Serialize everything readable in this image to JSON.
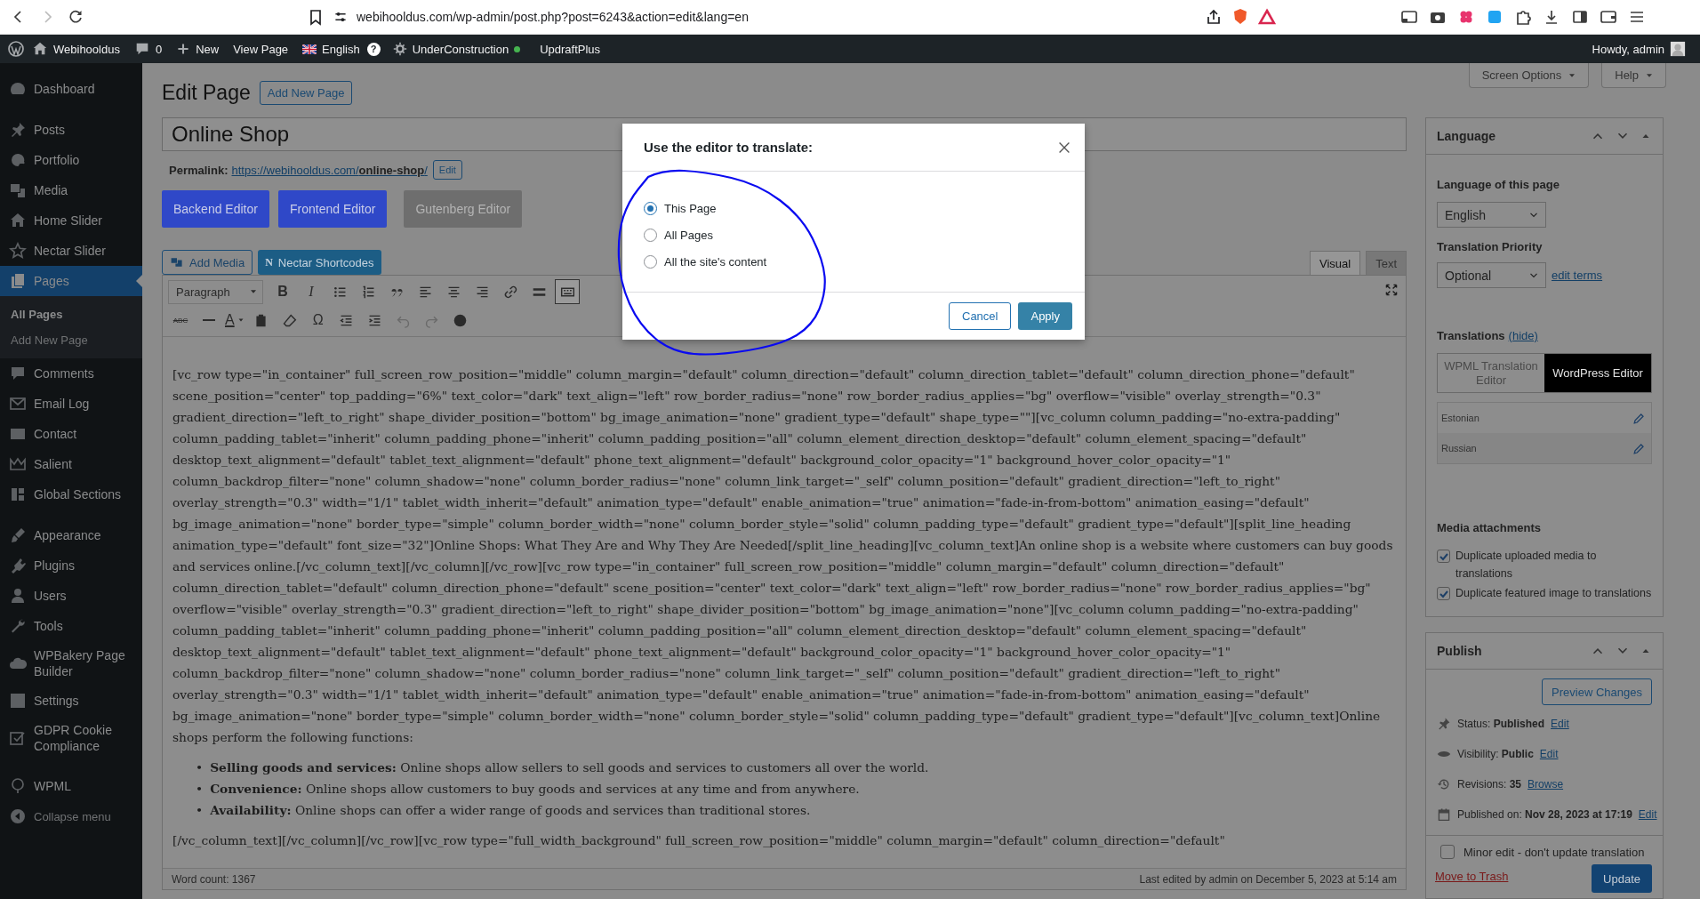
{
  "browser": {
    "url": "webihooldus.com/wp-admin/post.php?post=6243&action=edit&lang=en"
  },
  "admin_bar": {
    "site": "Webihooldus",
    "comments": "0",
    "new": "New",
    "view_page": "View Page",
    "language": "English",
    "help": "?",
    "under_construction": {
      "label": "UnderConstruction",
      "active": true
    },
    "updraft": "UpdraftPlus",
    "greeting": "Howdy, admin"
  },
  "sidebar": {
    "groups": [
      {
        "items": [
          {
            "label": "Dashboard",
            "selected": false
          }
        ]
      },
      {
        "items": [
          {
            "label": "Posts",
            "selected": false
          },
          {
            "label": "Portfolio",
            "selected": false
          },
          {
            "label": "Media",
            "selected": false
          },
          {
            "label": "Home Slider",
            "selected": false
          },
          {
            "label": "Nectar Slider",
            "selected": false
          },
          {
            "label": "Pages",
            "selected": true,
            "children": [
              {
                "label": "All Pages",
                "selected": true
              },
              {
                "label": "Add New Page",
                "selected": false
              }
            ]
          },
          {
            "label": "Comments",
            "selected": false
          },
          {
            "label": "Email Log",
            "selected": false
          },
          {
            "label": "Contact",
            "selected": false
          },
          {
            "label": "Salient",
            "selected": false
          },
          {
            "label": "Global Sections",
            "selected": false
          }
        ]
      },
      {
        "items": [
          {
            "label": "Appearance",
            "selected": false
          },
          {
            "label": "Plugins",
            "selected": false
          },
          {
            "label": "Users",
            "selected": false
          },
          {
            "label": "Tools",
            "selected": false
          },
          {
            "label": "WPBakery Page Builder",
            "selected": false
          },
          {
            "label": "Settings",
            "selected": false
          },
          {
            "label": "GDPR Cookie Compliance",
            "selected": false
          }
        ]
      },
      {
        "items": [
          {
            "label": "WPML",
            "selected": false
          }
        ]
      }
    ],
    "collapse": "Collapse menu"
  },
  "screen_tabs": [
    "Screen Options",
    "Help"
  ],
  "heading": "Edit Page",
  "add_new": "Add New Page",
  "editor": {
    "title": "Online Shop",
    "permalink_label": "Permalink:",
    "permalink_url": "https://webihooldus.com/**online-shop**/",
    "permalink_edit": "Edit",
    "builder_buttons": [
      {
        "label": "Backend Editor",
        "disabled": false
      },
      {
        "label": "Frontend Editor",
        "disabled": false
      },
      {
        "label": "Gutenberg Editor",
        "disabled": true
      }
    ],
    "media_buttons": [
      {
        "label": "Add Media"
      },
      {
        "label": "Nectar Shortcodes",
        "glyph": "N"
      }
    ],
    "tabs": [
      {
        "label": "Visual",
        "selected": true
      },
      {
        "label": "Text",
        "selected": false
      }
    ],
    "toolbar": [
      [
        {
          "kind": "select",
          "text": "Paragraph",
          "pressed": false,
          "disabled": false
        },
        {
          "kind": "bold",
          "text": "B",
          "pressed": false,
          "disabled": false
        },
        {
          "kind": "italic",
          "text": "I",
          "pressed": false,
          "disabled": false
        },
        {
          "kind": "icon",
          "pressed": false,
          "disabled": false
        },
        {
          "kind": "icon",
          "pressed": false,
          "disabled": false
        },
        {
          "kind": "icon",
          "pressed": false,
          "disabled": false
        },
        {
          "kind": "icon",
          "pressed": false,
          "disabled": false
        },
        {
          "kind": "icon",
          "pressed": false,
          "disabled": false
        },
        {
          "kind": "icon",
          "pressed": false,
          "disabled": false
        },
        {
          "kind": "icon",
          "pressed": false,
          "disabled": false
        },
        {
          "kind": "icon",
          "pressed": false,
          "disabled": false
        },
        {
          "kind": "icon",
          "pressed": true,
          "disabled": false
        }
      ],
      [
        {
          "kind": "strike",
          "text": "ABC",
          "pressed": false,
          "disabled": false
        },
        {
          "kind": "icon",
          "pressed": false,
          "disabled": false
        },
        {
          "kind": "color",
          "text": "A",
          "pressed": false,
          "disabled": false
        },
        {
          "kind": "icon",
          "pressed": false,
          "disabled": false
        },
        {
          "kind": "icon",
          "pressed": false,
          "disabled": false
        },
        {
          "kind": "glyph",
          "text": "Ω",
          "pressed": false,
          "disabled": false
        },
        {
          "kind": "icon",
          "pressed": false,
          "disabled": false
        },
        {
          "kind": "icon",
          "pressed": false,
          "disabled": false
        },
        {
          "kind": "icon",
          "pressed": false,
          "disabled": true
        },
        {
          "kind": "icon",
          "pressed": false,
          "disabled": true
        },
        {
          "kind": "icon",
          "pressed": false,
          "disabled": false
        }
      ]
    ],
    "content": {
      "paragraph": "[vc_row type=\"in_container\" full_screen_row_position=\"middle\" column_margin=\"default\" column_direction=\"default\" column_direction_tablet=\"default\" column_direction_phone=\"default\" scene_position=\"center\" top_padding=\"6%\" text_color=\"dark\" text_align=\"left\" row_border_radius=\"none\" row_border_radius_applies=\"bg\" overflow=\"visible\" overlay_strength=\"0.3\" gradient_direction=\"left_to_right\" shape_divider_position=\"bottom\" bg_image_animation=\"none\" gradient_type=\"default\" shape_type=\"\"][vc_column column_padding=\"no-extra-padding\" column_padding_tablet=\"inherit\" column_padding_phone=\"inherit\" column_padding_position=\"all\" column_element_direction_desktop=\"default\" column_element_spacing=\"default\" desktop_text_alignment=\"default\" tablet_text_alignment=\"default\" phone_text_alignment=\"default\" background_color_opacity=\"1\" background_hover_color_opacity=\"1\" column_backdrop_filter=\"none\" column_shadow=\"none\" column_border_radius=\"none\" column_link_target=\"_self\" column_position=\"default\" gradient_direction=\"left_to_right\" overlay_strength=\"0.3\" width=\"1/1\" tablet_width_inherit=\"default\" animation_type=\"default\" enable_animation=\"true\" animation=\"fade-in-from-bottom\" animation_easing=\"default\" bg_image_animation=\"none\" border_type=\"simple\" column_border_width=\"none\" column_border_style=\"solid\" column_padding_type=\"default\" gradient_type=\"default\"][split_line_heading animation_type=\"default\" font_size=\"32\"]Online Shops: What They Are and Why They Are Needed[/split_line_heading][vc_column_text]An online shop is a website where customers can buy goods and services online.[/vc_column_text][/vc_column][/vc_row][vc_row type=\"in_container\" full_screen_row_position=\"middle\" column_margin=\"default\" column_direction=\"default\" column_direction_tablet=\"default\" column_direction_phone=\"default\" scene_position=\"center\" text_color=\"dark\" text_align=\"left\" row_border_radius=\"none\" row_border_radius_applies=\"bg\" overflow=\"visible\" overlay_strength=\"0.3\" gradient_direction=\"left_to_right\" shape_divider_position=\"bottom\" bg_image_animation=\"none\"][vc_column column_padding=\"no-extra-padding\" column_padding_tablet=\"inherit\" column_padding_phone=\"inherit\" column_padding_position=\"all\" column_element_direction_desktop=\"default\" column_element_spacing=\"default\" desktop_text_alignment=\"default\" tablet_text_alignment=\"default\" phone_text_alignment=\"default\" background_color_opacity=\"1\" background_hover_color_opacity=\"1\" column_backdrop_filter=\"none\" column_shadow=\"none\" column_border_radius=\"none\" column_link_target=\"_self\" column_position=\"default\" gradient_direction=\"left_to_right\" overlay_strength=\"0.3\" width=\"1/1\" tablet_width_inherit=\"default\" animation_type=\"default\" enable_animation=\"true\" animation=\"fade-in-from-bottom\" animation_easing=\"default\" bg_image_animation=\"none\" border_type=\"simple\" column_border_width=\"none\" column_border_style=\"solid\" column_padding_type=\"default\" gradient_type=\"default\"][vc_column_text]Online shops perform the following functions:",
      "bullet": "•",
      "list": [
        "**Selling goods and services:** Online shops allow sellers to sell goods and services to customers all over the world.",
        "**Convenience:** Online shops allow customers to buy goods and services at any time and from anywhere.",
        "**Availability:** Online shops can offer a wider range of goods and services than traditional stores."
      ],
      "tail": "[/vc_column_text][/vc_column][/vc_row][vc_row type=\"full_width_background\" full_screen_row_position=\"middle\" column_margin=\"default\" column_direction=\"default\""
    },
    "word_count": "Word count: 1367",
    "last_edited": "Last edited by admin on December 5, 2023 at 5:14 am"
  },
  "language_box": {
    "title": "Language",
    "language_label": "Language of this page",
    "language": "English",
    "priority_label": "Translation Priority",
    "priority": "Optional",
    "edit_terms": "edit terms",
    "translations_label": "Translations",
    "hide": "(hide)",
    "editor_choice": [
      {
        "label": "WPML Translation Editor",
        "selected": false
      },
      {
        "label": "WordPress Editor",
        "selected": true
      }
    ],
    "translations": [
      "Estonian",
      "Russian"
    ],
    "media_label": "Media attachments",
    "options": [
      {
        "label": "Duplicate uploaded media to translations",
        "checked": true
      },
      {
        "label": "Duplicate featured image to translations",
        "checked": true
      }
    ]
  },
  "publish_box": {
    "title": "Publish",
    "preview": "Preview Changes",
    "rows": [
      {
        "text": "Status: **Published**",
        "link": "Edit"
      },
      {
        "text": "Visibility: **Public**",
        "link": "Edit"
      },
      {
        "text": "Revisions: **35**",
        "link": "Browse"
      },
      {
        "text": "Published on: **Nov 28, 2023 at 17:19**",
        "link": "Edit"
      }
    ],
    "minor_edit": {
      "label": "Minor edit - don't update translation",
      "checked": false
    },
    "trash": "Move to Trash",
    "update": "Update"
  },
  "modal": {
    "title": "Use the editor to translate:",
    "options": [
      {
        "label": "This Page",
        "selected": true
      },
      {
        "label": "All Pages",
        "selected": false
      },
      {
        "label": "All the site's content",
        "selected": false
      }
    ],
    "cancel": "Cancel",
    "apply": "Apply"
  }
}
